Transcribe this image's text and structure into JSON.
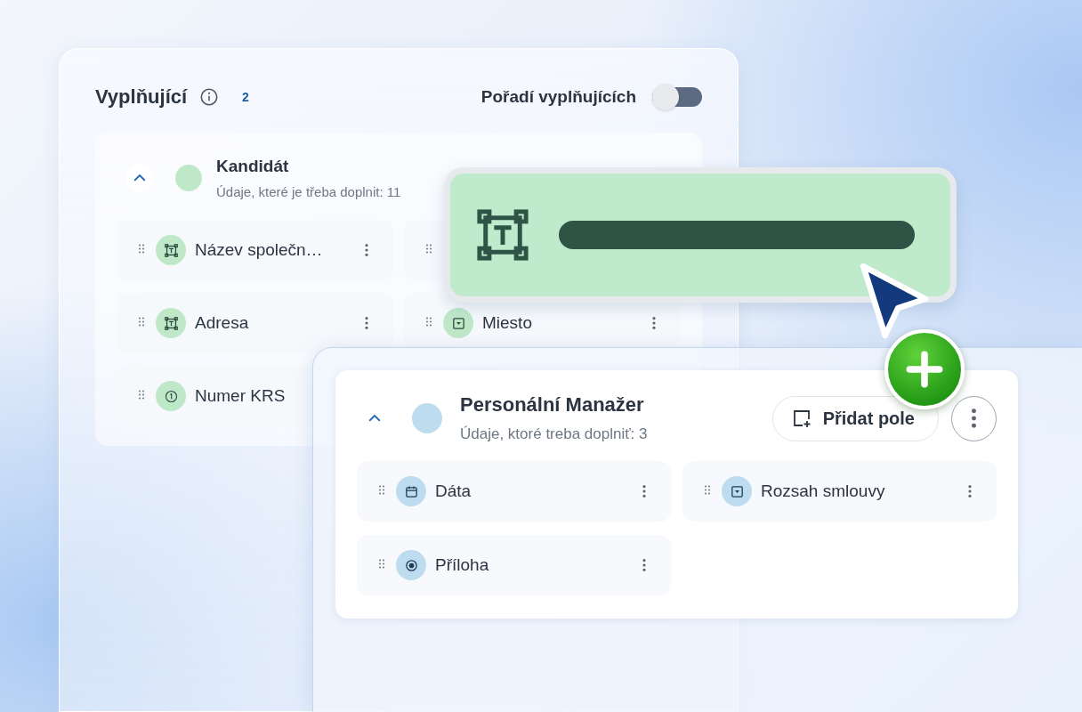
{
  "panel": {
    "title": "Vyplňující",
    "count": "2",
    "order_label": "Pořadí vyplňujících",
    "order_toggle": {
      "on": false
    }
  },
  "groups": [
    {
      "name": "Kandidát",
      "subtitle": "Údaje, které je třeba doplnit: 11",
      "color": "#bfe8c8",
      "expanded": true,
      "fields": [
        {
          "label": "Název společn…",
          "kind": "text"
        },
        {
          "kind": "covered"
        },
        {
          "label": "Adresa",
          "kind": "text"
        },
        {
          "label": "Miesto",
          "kind": "select"
        },
        {
          "label": "Numer KRS",
          "kind": "number"
        }
      ]
    },
    {
      "name": "Personální Manažer",
      "subtitle": "Údaje, ktoré treba doplniť: 3",
      "color": "#bddcef",
      "expanded": true,
      "add_label": "Přidat pole",
      "fields": [
        {
          "label": "Dáta",
          "kind": "date"
        },
        {
          "label": "Rozsah smlouvy",
          "kind": "select"
        },
        {
          "label": "Příloha",
          "kind": "radio"
        }
      ]
    }
  ],
  "drag_preview": {
    "kind": "text"
  }
}
